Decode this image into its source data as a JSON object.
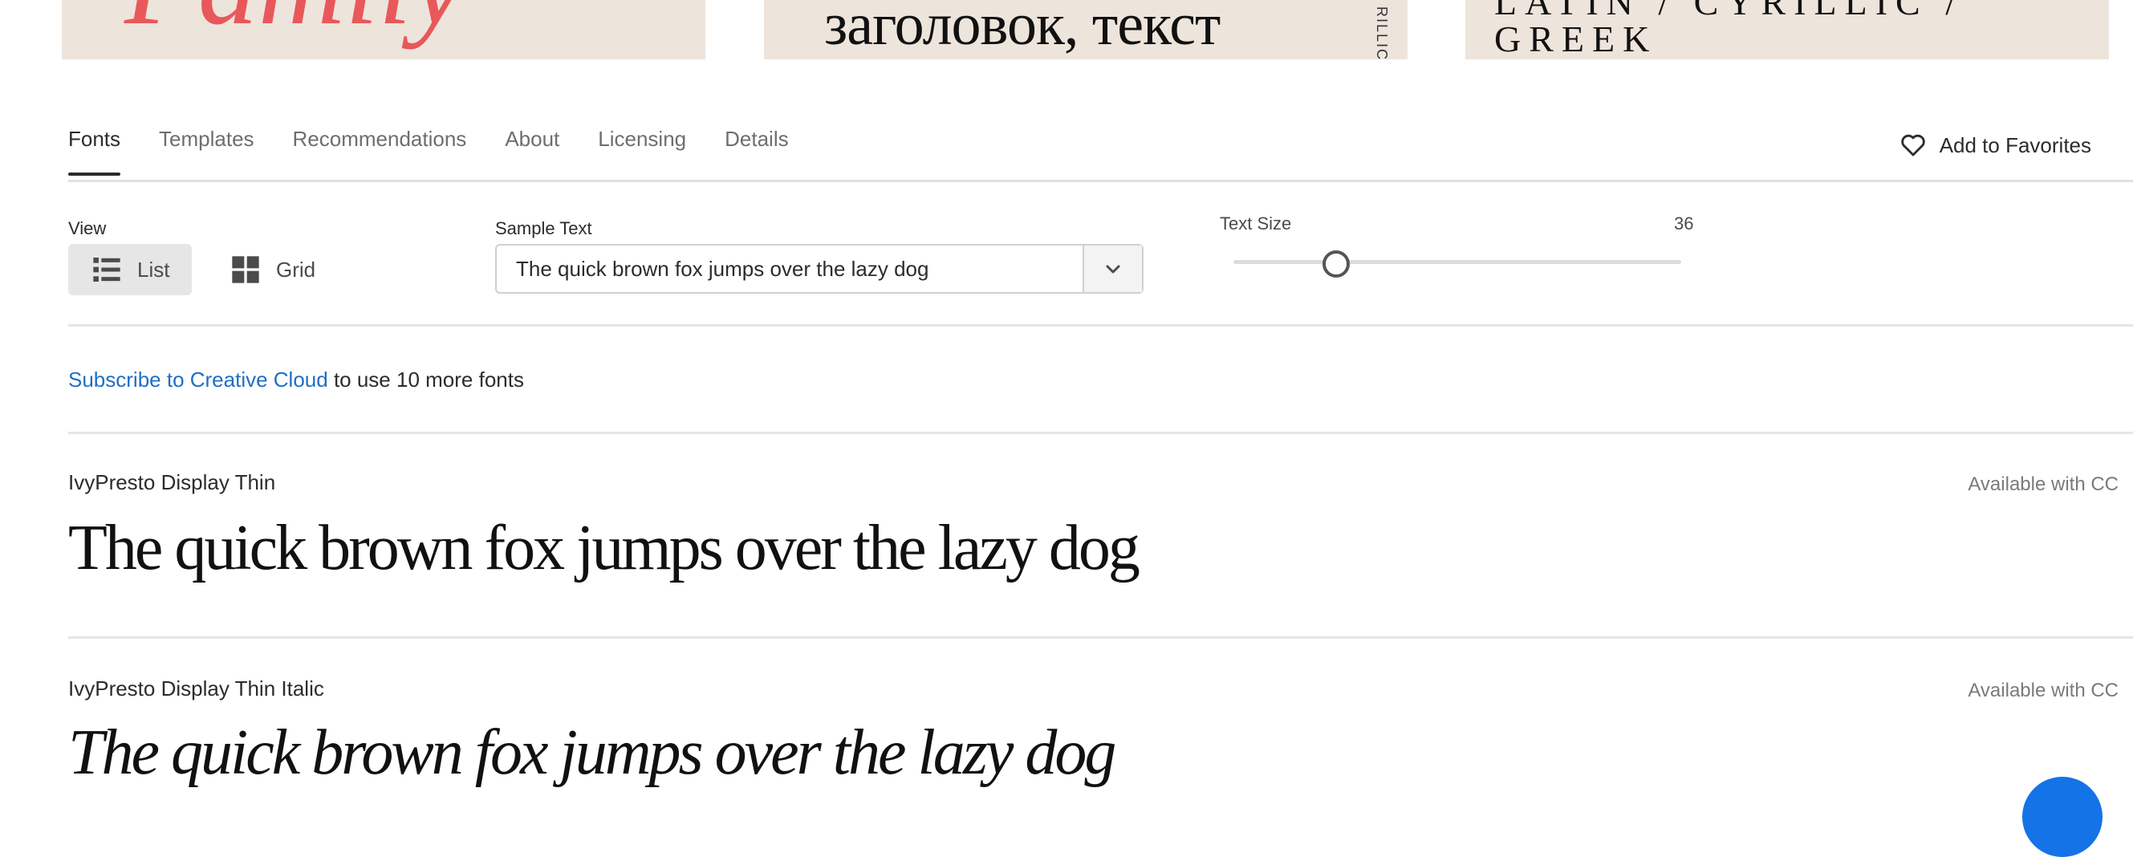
{
  "promos": {
    "promo1_text": "Family",
    "promo2_text": "заголовок, текст",
    "promo2_vertical": "RILLIC",
    "promo3_text": "LATIN / CYRILLIC / GREEK"
  },
  "tabs": [
    {
      "label": "Fonts",
      "active": true
    },
    {
      "label": "Templates",
      "active": false
    },
    {
      "label": "Recommendations",
      "active": false
    },
    {
      "label": "About",
      "active": false
    },
    {
      "label": "Licensing",
      "active": false
    },
    {
      "label": "Details",
      "active": false
    }
  ],
  "favorites": {
    "label": "Add to Favorites",
    "icon": "heart-icon"
  },
  "view": {
    "label": "View",
    "list_label": "List",
    "grid_label": "Grid",
    "selected": "List"
  },
  "sample_text": {
    "label": "Sample Text",
    "value": "The quick brown fox jumps over the lazy dog"
  },
  "text_size": {
    "label": "Text Size",
    "value": "36"
  },
  "subscribe": {
    "link": "Subscribe to Creative Cloud",
    "rest": " to use 10 more fonts"
  },
  "fonts": [
    {
      "name": "IvyPresto Display Thin",
      "availability": "Available with CC",
      "sample": "The quick brown fox jumps over the lazy dog"
    },
    {
      "name": "IvyPresto Display Thin Italic",
      "availability": "Available with CC",
      "sample": "The quick brown fox jumps over the lazy dog"
    }
  ],
  "colors": {
    "link": "#1f6ec5",
    "promo_bg": "#ede4dc",
    "promo_accent": "#e8585a",
    "fab": "#1473e6"
  }
}
